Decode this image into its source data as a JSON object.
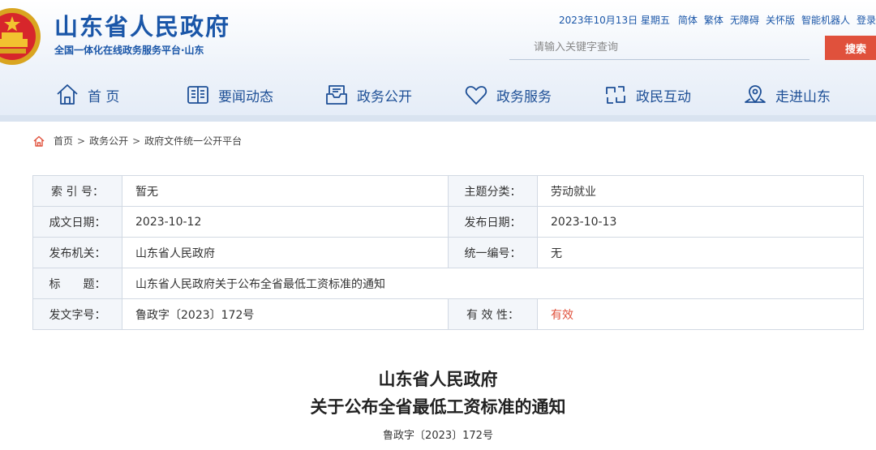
{
  "header": {
    "site_title": "山东省人民政府",
    "site_subtitle": "全国一体化在线政务服务平台·山东",
    "date": "2023年10月13日 星期五",
    "top_links": [
      "简体",
      "繁体",
      "无障碍",
      "关怀版",
      "智能机器人",
      "登录"
    ],
    "search_placeholder": "请输入关键字查询",
    "search_button": "搜索"
  },
  "nav": {
    "items": [
      {
        "label": "首 页",
        "icon": "home-icon"
      },
      {
        "label": "要闻动态",
        "icon": "book-icon"
      },
      {
        "label": "政务公开",
        "icon": "inbox-icon"
      },
      {
        "label": "政务服务",
        "icon": "heart-icon"
      },
      {
        "label": "政民互动",
        "icon": "interact-icon"
      },
      {
        "label": "走进山东",
        "icon": "map-pin-icon"
      }
    ]
  },
  "breadcrumb": {
    "items": [
      "首页",
      "政务公开",
      "政府文件统一公开平台"
    ],
    "separator": ">"
  },
  "info": {
    "index_label": "索 引 号：",
    "index_value": "暂无",
    "topic_label": "主题分类：",
    "topic_value": "劳动就业",
    "written_label": "成文日期：",
    "written_value": "2023-10-12",
    "publish_label": "发布日期：",
    "publish_value": "2023-10-13",
    "issuer_label": "发布机关：",
    "issuer_value": "山东省人民政府",
    "serial_label": "统一编号：",
    "serial_value": "无",
    "title_label": "标　　题：",
    "title_value": "山东省人民政府关于公布全省最低工资标准的通知",
    "docno_label": "发文字号：",
    "docno_value": "鲁政字〔2023〕172号",
    "validity_label": "有 效 性：",
    "validity_value": "有效"
  },
  "document": {
    "title_line1": "山东省人民政府",
    "title_line2": "关于公布全省最低工资标准的通知",
    "doc_number": "鲁政字〔2023〕172号"
  },
  "colors": {
    "brand_blue": "#1a56a8",
    "accent_red": "#e0513c",
    "nav_text": "#1d4f96"
  }
}
